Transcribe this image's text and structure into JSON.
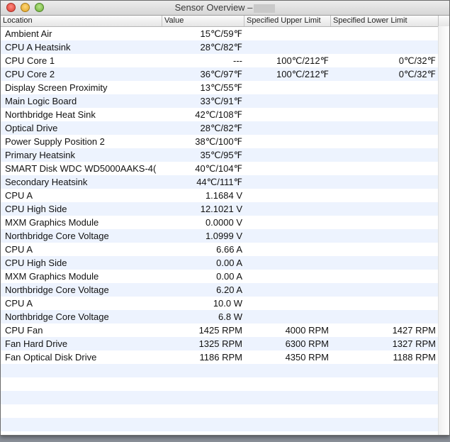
{
  "window": {
    "title": "Sensor Overview –"
  },
  "columns": {
    "location": "Location",
    "value": "Value",
    "upper": "Specified Upper Limit",
    "lower": "Specified Lower Limit"
  },
  "rows": [
    {
      "location": "Ambient Air",
      "value": "15℃/59℉",
      "upper": "",
      "lower": ""
    },
    {
      "location": "CPU A Heatsink",
      "value": "28℃/82℉",
      "upper": "",
      "lower": ""
    },
    {
      "location": "CPU Core 1",
      "value": "---",
      "upper": "100℃/212℉",
      "lower": "0℃/32℉"
    },
    {
      "location": "CPU Core 2",
      "value": "36℃/97℉",
      "upper": "100℃/212℉",
      "lower": "0℃/32℉"
    },
    {
      "location": "Display Screen Proximity",
      "value": "13℃/55℉",
      "upper": "",
      "lower": ""
    },
    {
      "location": "Main Logic Board",
      "value": "33℃/91℉",
      "upper": "",
      "lower": ""
    },
    {
      "location": "Northbridge Heat Sink",
      "value": "42℃/108℉",
      "upper": "",
      "lower": ""
    },
    {
      "location": "Optical Drive",
      "value": "28℃/82℉",
      "upper": "",
      "lower": ""
    },
    {
      "location": "Power Supply Position 2",
      "value": "38℃/100℉",
      "upper": "",
      "lower": ""
    },
    {
      "location": "Primary Heatsink",
      "value": "35℃/95℉",
      "upper": "",
      "lower": ""
    },
    {
      "location": "SMART Disk WDC WD5000AAKS-4(",
      "value": "40℃/104℉",
      "upper": "",
      "lower": ""
    },
    {
      "location": "Secondary Heatsink",
      "value": "44℃/111℉",
      "upper": "",
      "lower": ""
    },
    {
      "location": "CPU A",
      "value": "1.1684 V",
      "upper": "",
      "lower": ""
    },
    {
      "location": "CPU High Side",
      "value": "12.1021 V",
      "upper": "",
      "lower": ""
    },
    {
      "location": "MXM Graphics Module",
      "value": "0.0000 V",
      "upper": "",
      "lower": ""
    },
    {
      "location": "Northbridge Core Voltage",
      "value": "1.0999 V",
      "upper": "",
      "lower": ""
    },
    {
      "location": "CPU A",
      "value": "6.66 A",
      "upper": "",
      "lower": ""
    },
    {
      "location": "CPU High Side",
      "value": "0.00 A",
      "upper": "",
      "lower": ""
    },
    {
      "location": "MXM Graphics Module",
      "value": "0.00 A",
      "upper": "",
      "lower": ""
    },
    {
      "location": "Northbridge Core Voltage",
      "value": "6.20 A",
      "upper": "",
      "lower": ""
    },
    {
      "location": "CPU A",
      "value": "10.0 W",
      "upper": "",
      "lower": ""
    },
    {
      "location": "Northbridge Core Voltage",
      "value": "6.8 W",
      "upper": "",
      "lower": ""
    },
    {
      "location": "CPU Fan",
      "value": "1425 RPM",
      "upper": "4000 RPM",
      "lower": "1427 RPM"
    },
    {
      "location": "Fan Hard Drive",
      "value": "1325 RPM",
      "upper": "6300 RPM",
      "lower": "1327 RPM"
    },
    {
      "location": "Fan Optical Disk Drive",
      "value": "1186 RPM",
      "upper": "4350 RPM",
      "lower": "1188 RPM"
    }
  ],
  "empty_rows": 5
}
